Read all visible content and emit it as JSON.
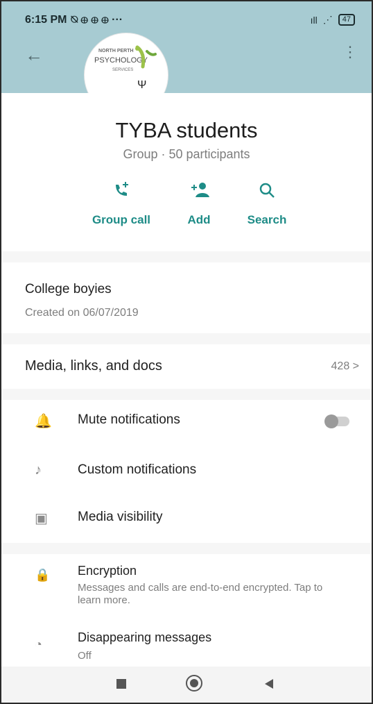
{
  "status_bar": {
    "time": "6:15 PM",
    "battery": "47"
  },
  "group": {
    "title": "TYBA  students",
    "subtitle": "Group · 50 participants",
    "logo": {
      "line1": "NORTH PERTH",
      "line2": "PSYCHOLOGY",
      "line3": "SERVICES",
      "psi": "Ψ"
    }
  },
  "actions": [
    {
      "label": "Group call",
      "icon": "group-call-icon"
    },
    {
      "label": "Add",
      "icon": "add-participant-icon"
    },
    {
      "label": "Search",
      "icon": "search-icon"
    }
  ],
  "description": {
    "title": "College boyies",
    "created": "Created on 06/07/2019"
  },
  "media": {
    "label": "Media, links, and docs",
    "count": "428 >"
  },
  "settings": [
    {
      "label": "Mute notifications",
      "icon": "bell-icon"
    },
    {
      "label": "Custom notifications",
      "icon": "music-note-icon"
    },
    {
      "label": "Media visibility",
      "icon": "image-icon"
    }
  ],
  "encryption": {
    "label": "Encryption",
    "description": "Messages and calls are end-to-end encrypted. Tap to learn more."
  },
  "disappearing": {
    "label": "Disappearing messages",
    "value": "Off"
  },
  "colors": {
    "accent": "#1e8c87",
    "header": "#a7cbd2"
  }
}
